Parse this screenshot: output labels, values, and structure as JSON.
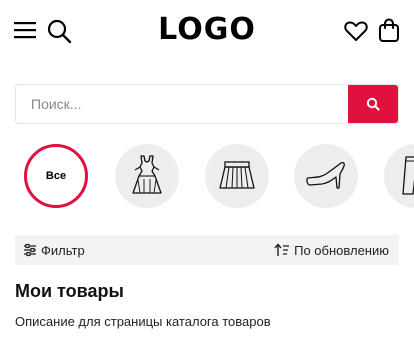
{
  "header": {
    "logo": "LOGO",
    "icons": {
      "menu": "hamburger-menu-icon",
      "search": "search-icon",
      "wishlist": "heart-icon",
      "cart": "shopping-bag-icon"
    }
  },
  "search": {
    "placeholder": "Поиск...",
    "value": "",
    "button_icon": "search-icon"
  },
  "categories": [
    {
      "label": "Все",
      "icon": null,
      "active": true
    },
    {
      "label": "",
      "icon": "dress-icon",
      "active": false
    },
    {
      "label": "",
      "icon": "skirt-icon",
      "active": false
    },
    {
      "label": "",
      "icon": "high-heel-shoe-icon",
      "active": false
    },
    {
      "label": "",
      "icon": "trousers-icon",
      "active": false
    }
  ],
  "toolbar": {
    "filter_label": "Фильтр",
    "filter_icon": "sliders-icon",
    "sort_label": "По обновлению",
    "sort_icon": "sort-icon"
  },
  "page": {
    "title": "Мои товары",
    "description": "Описание для страницы каталога товаров"
  },
  "colors": {
    "accent": "#e0103f",
    "category_bg": "#ededed",
    "filter_bar_bg": "#f3f3f3"
  }
}
